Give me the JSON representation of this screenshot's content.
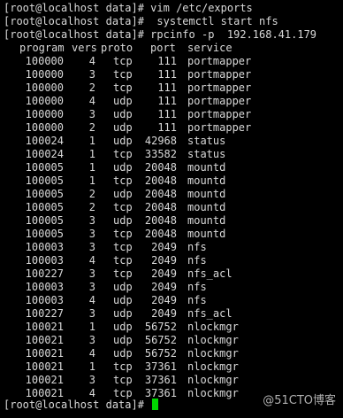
{
  "terminal": {
    "prompt": "[root@localhost data]# ",
    "commands": [
      "vim /etc/exports",
      " systemctl start nfs",
      "rpcinfo -p  192.168.41.179"
    ],
    "header": {
      "program": "program",
      "vers": "vers",
      "proto": "proto",
      "port": "port",
      "service": "service"
    },
    "rows": [
      {
        "program": "100000",
        "vers": "4",
        "proto": "tcp",
        "port": "111",
        "service": "portmapper"
      },
      {
        "program": "100000",
        "vers": "3",
        "proto": "tcp",
        "port": "111",
        "service": "portmapper"
      },
      {
        "program": "100000",
        "vers": "2",
        "proto": "tcp",
        "port": "111",
        "service": "portmapper"
      },
      {
        "program": "100000",
        "vers": "4",
        "proto": "udp",
        "port": "111",
        "service": "portmapper"
      },
      {
        "program": "100000",
        "vers": "3",
        "proto": "udp",
        "port": "111",
        "service": "portmapper"
      },
      {
        "program": "100000",
        "vers": "2",
        "proto": "udp",
        "port": "111",
        "service": "portmapper"
      },
      {
        "program": "100024",
        "vers": "1",
        "proto": "udp",
        "port": "42968",
        "service": "status"
      },
      {
        "program": "100024",
        "vers": "1",
        "proto": "tcp",
        "port": "33582",
        "service": "status"
      },
      {
        "program": "100005",
        "vers": "1",
        "proto": "udp",
        "port": "20048",
        "service": "mountd"
      },
      {
        "program": "100005",
        "vers": "1",
        "proto": "tcp",
        "port": "20048",
        "service": "mountd"
      },
      {
        "program": "100005",
        "vers": "2",
        "proto": "udp",
        "port": "20048",
        "service": "mountd"
      },
      {
        "program": "100005",
        "vers": "2",
        "proto": "tcp",
        "port": "20048",
        "service": "mountd"
      },
      {
        "program": "100005",
        "vers": "3",
        "proto": "udp",
        "port": "20048",
        "service": "mountd"
      },
      {
        "program": "100005",
        "vers": "3",
        "proto": "tcp",
        "port": "20048",
        "service": "mountd"
      },
      {
        "program": "100003",
        "vers": "3",
        "proto": "tcp",
        "port": "2049",
        "service": "nfs"
      },
      {
        "program": "100003",
        "vers": "4",
        "proto": "tcp",
        "port": "2049",
        "service": "nfs"
      },
      {
        "program": "100227",
        "vers": "3",
        "proto": "tcp",
        "port": "2049",
        "service": "nfs_acl"
      },
      {
        "program": "100003",
        "vers": "3",
        "proto": "udp",
        "port": "2049",
        "service": "nfs"
      },
      {
        "program": "100003",
        "vers": "4",
        "proto": "udp",
        "port": "2049",
        "service": "nfs"
      },
      {
        "program": "100227",
        "vers": "3",
        "proto": "udp",
        "port": "2049",
        "service": "nfs_acl"
      },
      {
        "program": "100021",
        "vers": "1",
        "proto": "udp",
        "port": "56752",
        "service": "nlockmgr"
      },
      {
        "program": "100021",
        "vers": "3",
        "proto": "udp",
        "port": "56752",
        "service": "nlockmgr"
      },
      {
        "program": "100021",
        "vers": "4",
        "proto": "udp",
        "port": "56752",
        "service": "nlockmgr"
      },
      {
        "program": "100021",
        "vers": "1",
        "proto": "tcp",
        "port": "37361",
        "service": "nlockmgr"
      },
      {
        "program": "100021",
        "vers": "3",
        "proto": "tcp",
        "port": "37361",
        "service": "nlockmgr"
      },
      {
        "program": "100021",
        "vers": "4",
        "proto": "tcp",
        "port": "37361",
        "service": "nlockmgr"
      }
    ],
    "final_prompt": "[root@localhost data]# ",
    "cursor_color": "#00d700"
  },
  "watermark": "@51CTO博客"
}
